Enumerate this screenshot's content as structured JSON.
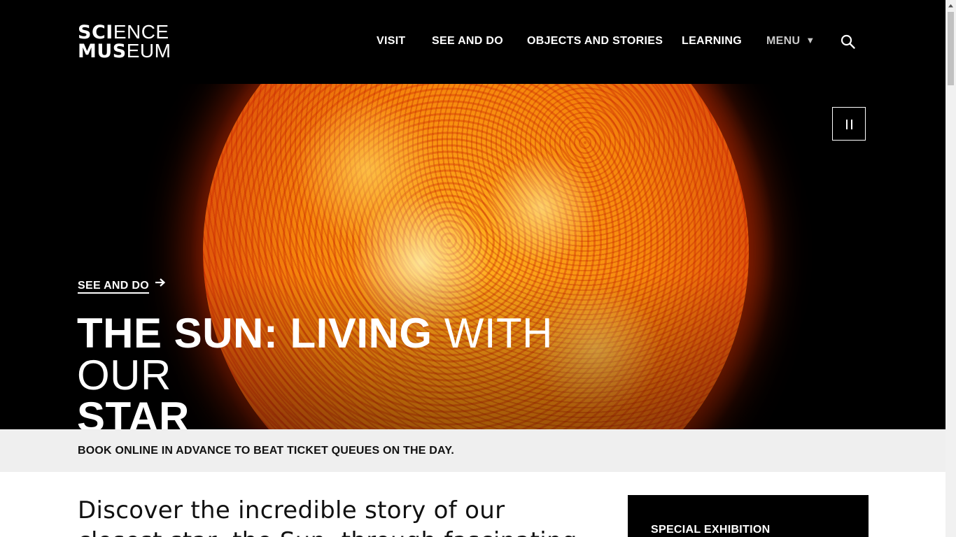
{
  "header": {
    "logo": {
      "line1_bold": "SCI",
      "line1_light": "ENCE",
      "line2_bold": "MUS",
      "line2_light": "EUM"
    },
    "nav": [
      {
        "label": "VISIT"
      },
      {
        "label": "SEE AND DO"
      },
      {
        "label": "OBJECTS AND STORIES"
      },
      {
        "label": "LEARNING"
      }
    ],
    "menu": {
      "label": "MENU",
      "caret": "▼"
    },
    "search_icon": "search-icon"
  },
  "hero": {
    "category": "SEE AND DO",
    "title_part1_bold": "THE SUN: LIVING ",
    "title_part2_light": "WITH OUR ",
    "title_part3_bold": "STAR",
    "pause_icon": "pause-icon"
  },
  "notice": {
    "text": "BOOK ONLINE IN ADVANCE TO BEAT TICKET QUEUES ON THE DAY."
  },
  "intro": {
    "text": "Discover the incredible story of our closest star, the Sun, through fascinating"
  },
  "sidebar": {
    "special_label": "SPECIAL EXHIBITION"
  },
  "colors": {
    "header_bg": "#000000",
    "notice_bg": "#efefef",
    "text": "#111111",
    "menu_text": "#c9c9c9"
  }
}
